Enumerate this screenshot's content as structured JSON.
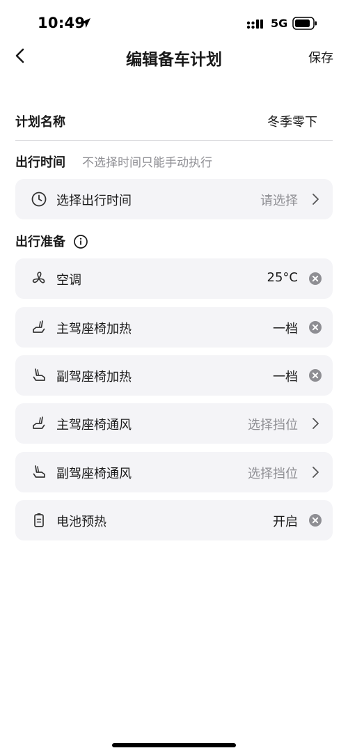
{
  "status_bar": {
    "time": "10:49",
    "network": "5G"
  },
  "nav": {
    "title": "编辑备车计划",
    "save_label": "保存"
  },
  "plan_name": {
    "label": "计划名称",
    "value": "冬季零下"
  },
  "departure": {
    "title": "出行时间",
    "hint": "不选择时间只能手动执行",
    "row": {
      "label": "选择出行时间",
      "value": "请选择"
    }
  },
  "prep": {
    "title": "出行准备",
    "items": [
      {
        "label": "空调",
        "value": "25°C",
        "icon": "fan-icon",
        "action": "remove"
      },
      {
        "label": "主驾座椅加热",
        "value": "一档",
        "icon": "driver-seat-icon",
        "action": "remove"
      },
      {
        "label": "副驾座椅加热",
        "value": "一档",
        "icon": "passenger-seat-icon",
        "action": "remove"
      },
      {
        "label": "主驾座椅通风",
        "value": "选择挡位",
        "icon": "driver-seat-icon",
        "action": "select"
      },
      {
        "label": "副驾座椅通风",
        "value": "选择挡位",
        "icon": "passenger-seat-icon",
        "action": "select"
      },
      {
        "label": "电池预热",
        "value": "开启",
        "icon": "battery-heat-icon",
        "action": "remove"
      }
    ]
  },
  "colors": {
    "text_primary": "#1a1a1a",
    "text_secondary": "#8e8e93",
    "card_bg": "#f4f4f7",
    "remove_icon": "#8e8e93"
  }
}
